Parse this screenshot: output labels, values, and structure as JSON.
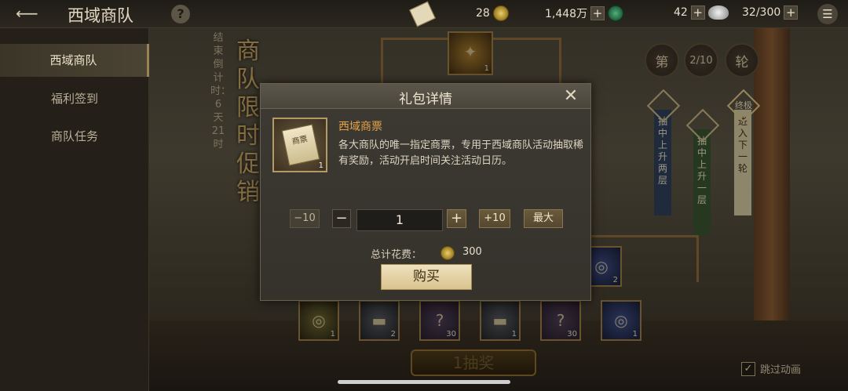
{
  "topbar": {
    "title": "西域商队",
    "help_label": "?",
    "resources": [
      {
        "value": "28",
        "icon": "coin-icon"
      },
      {
        "value": "1,448万",
        "icon": "jade-icon"
      },
      {
        "value": "42",
        "icon": "silver-icon"
      },
      {
        "value": "32/300",
        "icon": "menu-icon"
      }
    ],
    "plus_label": "+",
    "menu_glyph": "☰"
  },
  "sidebar": {
    "items": [
      {
        "label": "西域商队",
        "active": true
      },
      {
        "label": "福利签到",
        "active": false
      },
      {
        "label": "商队任务",
        "active": false
      }
    ]
  },
  "scene": {
    "countdown": "结束倒计时：6天21时",
    "promo": "商队限时促销",
    "badges": [
      "第",
      "2/10",
      "轮"
    ],
    "tiers": [
      "抽中上升两层",
      "抽中上升一层",
      "进入下一轮"
    ],
    "tier_cap_label": "终极",
    "prizes": [
      {
        "count": "1",
        "style": "coin",
        "glyph": "◎"
      },
      {
        "count": "2",
        "style": "bar",
        "glyph": "▬"
      },
      {
        "count": "30",
        "style": "",
        "glyph": "?"
      },
      {
        "count": "1",
        "style": "bar",
        "glyph": "▬"
      },
      {
        "count": "30",
        "style": "",
        "glyph": "?"
      },
      {
        "count": "1",
        "style": "blue",
        "glyph": "◎"
      }
    ],
    "side_prize_count": "2",
    "top_prize_count": "1",
    "draw_button": "1抽奖",
    "skip_label": "跳过动画",
    "skip_checked": "✓"
  },
  "dialog": {
    "title": "礼包详情",
    "close_glyph": "✕",
    "item_name": "西域商票",
    "item_icon_text": "商票",
    "item_qty": "1",
    "item_desc": "各大商队的唯一指定商票，专用于西域商队活动抽取稀有奖励，活动开启时间关注活动日历。",
    "btn_minus10": "−10",
    "btn_minus": "−",
    "qty_value": "1",
    "btn_plus": "+",
    "btn_plus10": "+10",
    "btn_max": "最大",
    "cost_label": "总计花费：",
    "cost_value": "300",
    "buy_label": "购买"
  }
}
